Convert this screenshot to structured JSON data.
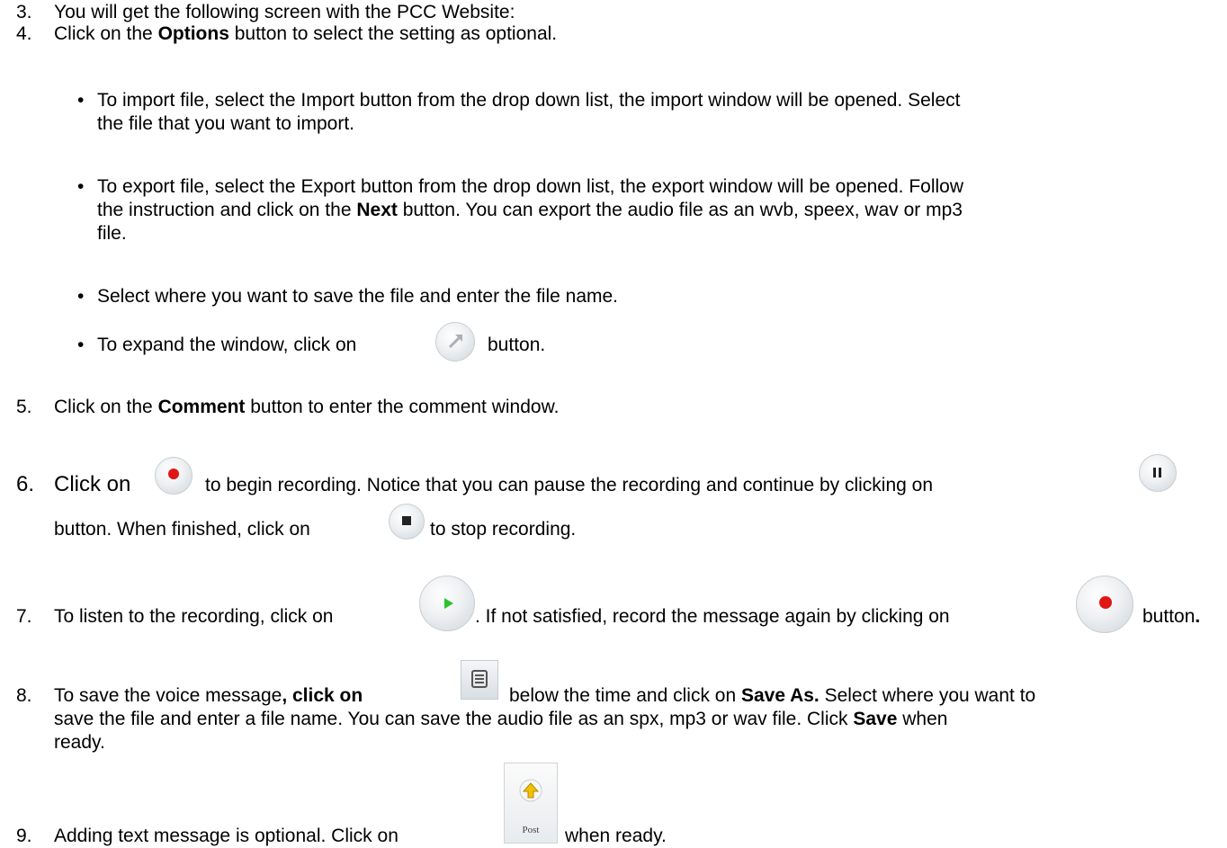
{
  "steps": {
    "s3": {
      "num": "3.",
      "text": "You will get the following screen with the PCC Website:"
    },
    "s4": {
      "num": "4.",
      "pre": "Click on the ",
      "bold": "Options",
      "post": " button to select the setting as optional."
    },
    "bullets": {
      "b1_line1": "To import file, select the Import button from the drop down list, the import window will be opened. Select",
      "b1_line2": "the file that you want to import.",
      "b2_line1": "To export file, select the Export button from the drop down list, the export window will be opened. Follow",
      "b2_line2_pre": "the instruction and click on the ",
      "b2_line2_bold": "Next",
      "b2_line2_post": " button. You can export the audio file as an wvb, speex, wav or mp3",
      "b2_line3": "file.",
      "b3": "Select where you want to save the file and enter the file name.",
      "b4_pre": "To expand the window, click on",
      "b4_post": "button."
    },
    "s5": {
      "num": "5.",
      "pre": "Click on the ",
      "bold": "Comment",
      "post": " button to enter the comment window."
    },
    "s6": {
      "num": "6.",
      "pre": "Click on",
      "mid": "to begin recording. Notice that you can pause the recording and continue by clicking on",
      "line2_pre": "button. When finished, click on",
      "line2_post": "to stop recording."
    },
    "s7": {
      "num": "7.",
      "pre": "To listen to the recording, click on",
      "mid": ". If not satisfied, record the message again by clicking on",
      "post": "button",
      "post_bold": "."
    },
    "s8": {
      "num": "8.",
      "pre": "To save the voice message",
      "bold1": ", click on",
      "mid": "below the time and click on ",
      "bold2": "Save As.",
      "post": " Select where you want to",
      "line2_pre": "save the file and enter a file name. You can save the audio file as an spx, mp3 or wav file. Click ",
      "line2_bold": "Save",
      "line2_post": " when",
      "line3": "ready."
    },
    "s9": {
      "num": "9.",
      "pre": "Adding text message is optional. Click on",
      "post": "when ready.",
      "post_button_label": "Post"
    }
  },
  "icons": {
    "expand": "expand-arrow-icon",
    "record": "record-icon",
    "pause": "pause-icon",
    "stop": "stop-icon",
    "play": "play-icon",
    "menu": "menu-list-icon",
    "post": "post-upload-icon"
  },
  "colors": {
    "record_red": "#e01515",
    "play_green": "#2ec22e",
    "post_arrow": "#f2c200"
  }
}
